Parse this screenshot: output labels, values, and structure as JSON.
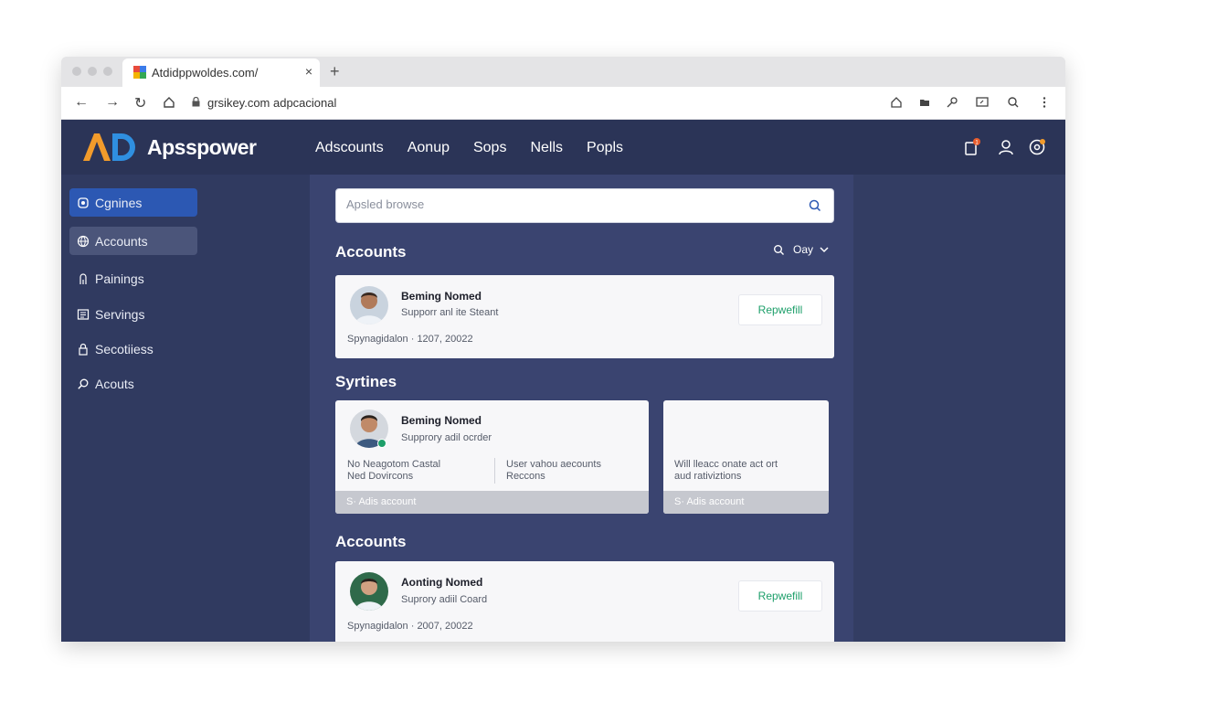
{
  "browser": {
    "tab_title": "Atdidppwoldes.com/",
    "tab_close": "×",
    "new_tab": "+",
    "url": "grsikey.com adpcacional",
    "nav": {
      "back": "←",
      "forward": "→",
      "reload": "↻"
    }
  },
  "app": {
    "logo_mark": "AD",
    "logo_text": "Apsspower",
    "nav": [
      "Adscounts",
      "Aonup",
      "Sops",
      "Nells",
      "Popls"
    ],
    "notification_badge": "1"
  },
  "sidebar": {
    "items": [
      {
        "label": "Cgnines",
        "icon": "gear-icon",
        "state": "active"
      },
      {
        "label": "Accounts",
        "icon": "globe-icon",
        "state": "hover"
      },
      {
        "label": "Painings",
        "icon": "person-icon",
        "state": ""
      },
      {
        "label": "Servings",
        "icon": "list-icon",
        "state": ""
      },
      {
        "label": "Secotiiess",
        "icon": "lock-icon",
        "state": ""
      },
      {
        "label": "Acouts",
        "icon": "search-icon",
        "state": ""
      }
    ]
  },
  "search": {
    "placeholder": "Apsled browse"
  },
  "sections": {
    "accounts_top": "Accounts",
    "syrtines": "Syrtines",
    "accounts_bottom": "Accounts"
  },
  "sort": {
    "label": "Oay"
  },
  "card1": {
    "name": "Beming Nomed",
    "subtitle": "Supporr anl ite Steant",
    "meta": "Spynagidalon  ·  1207, 20022",
    "button": "Repwefill"
  },
  "card2": {
    "name": "Beming Nomed",
    "subtitle": "Supprory adil ocrder",
    "col1_line1": "No Neagotom Castal",
    "col1_line2": "Ned Dovircons",
    "col2_line1": "User vahou aecounts",
    "col2_line2": "Reccons",
    "footer": "S· Adis account"
  },
  "card3": {
    "line1": "Will lleacc onate act ort",
    "line2": "aud rativiztions",
    "footer": "S· Adis account"
  },
  "card4": {
    "name": "Aonting Nomed",
    "subtitle": "Suprory adiil Coard",
    "meta": "Spynagidalon  ·  2007, 20022",
    "button": "Repwefill"
  },
  "colors": {
    "header_bg": "#2b3457",
    "sidebar_bg": "#303a60",
    "main_bg": "#3a4470",
    "active_item": "#2c58b3",
    "button_text": "#1d9f6a",
    "logo_orange": "#f29b2b",
    "logo_blue": "#2f8fe0"
  }
}
